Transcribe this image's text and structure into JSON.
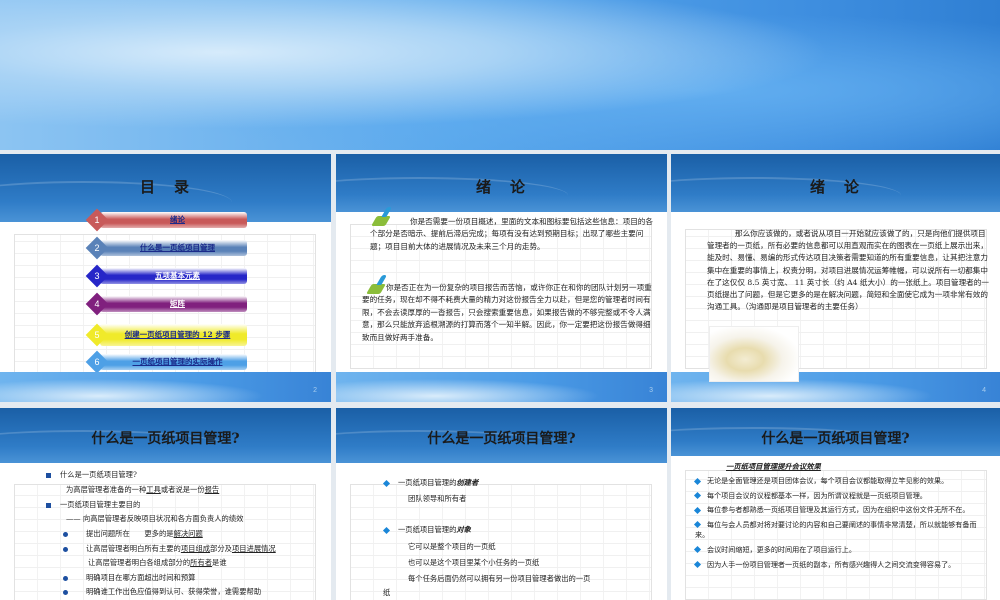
{
  "slides": [
    {
      "title": "目　录",
      "page": "2",
      "items": [
        {
          "num": "1",
          "label": "绪论",
          "color": "#c85a5a"
        },
        {
          "num": "2",
          "label": "什么是一页纸项目管理",
          "color": "#5a82b8"
        },
        {
          "num": "3",
          "label": "五项基本元素",
          "color": "#2626c8"
        },
        {
          "num": "4",
          "label": "矩阵",
          "color": "#80207e"
        },
        {
          "num": "5",
          "label": "创建一页纸项目管理的 12 步骤",
          "color": "#f0ea2a"
        },
        {
          "num": "6",
          "label": "一页纸项目管理的实际操作",
          "color": "#4ea0e6"
        }
      ]
    },
    {
      "title": "绪　论",
      "page": "3",
      "paragraphs": [
        "你是否需要一份项目概述，里面的文本和图标要包括这些信息：项目的各个部分是否暗示、提前后滞后完成；每项有没有达到预期目标；出现了哪些主要问题；项目目前大体的进展情况及未来三个月的走势。",
        "你是否正在为一份复杂的项目报告而苦恼，或许你正在和你的团队计划另一项重要的任务，现在却不得不耗费大量的精力对这份报告全力以赴，但是您的管理者时间有限，不会去读厚厚的一沓报告，只会搜索重要信息，如果报告做的不够完整或不令人满意，那么只能放弃追根溯源的打算而落个一知半解。因此，你一定要把这份报告做得细致而且做好两手准备。"
      ]
    },
    {
      "title": "绪　论",
      "page": "4",
      "paragraph": "那么你应该做的，或者说从项目一开始就应该做了的，只是向他们提供项目管理者的一页纸，所有必要的信息都可以用直观而实在的图表在一页纸上展示出来，能及时、易懂、易编的形式传达项目决策者需要知道的所有重要信息，让其把注意力集中在重要的事情上，权责分明，对项目进展情况运筹帷幄，可以说所有一切都集中在了这仅仅 8.5 英寸宽、 11 英寸长（约 A4 纸大小）的一张纸上。项目管理者的一页纸提出了问题，但是它更多的是在解决问题，简短和全面使它成为一项非常有效的沟通工具。（沟通即是项目管理者的主要任务）"
    },
    {
      "title": "什么是一页纸项目管理?",
      "q1": "什么是一页纸项目管理?",
      "a1_pre": "为高层管理者准备的一种",
      "a1_u1": "工具",
      "a1_mid": "或者说是一份",
      "a1_u2": "报告",
      "q2": "一页纸项目管理主要目的",
      "sub": "—— 向高层管理者反映项目状况和各方面负责人的绩效",
      "b1_pre": "提出问题所在　　更多的是",
      "b1_u": "解决问题",
      "b2_pre": "让高层管理者明白所有主要的",
      "b2_u1": "项目组成",
      "b2_mid": "部分及",
      "b2_u2": "项目进展情况",
      "b2b_pre": "让高层管理者明白各组成部分的",
      "b2b_u": "所有者",
      "b2b_post": "是谁",
      "b3": "明确项目在哪方面超出时间和预算",
      "b4": "明确谁工作出色应值得到认可、获得荣誉，谁需要帮助"
    },
    {
      "title": "什么是一页纸项目管理?",
      "c_pre": "一页纸项目管理的",
      "c_em": "创建者",
      "c_body": "团队领导和所有者",
      "o_pre": "一页纸项目管理的",
      "o_em": "对象",
      "o_lines": [
        "它可以是整个项目的一页纸",
        "也可以是这个项目里某个小任务的一页纸",
        "每个任务后面仍然可以拥有另一份项目管理者做出的一页"
      ],
      "o_tail": "纸"
    },
    {
      "title": "什么是一页纸项目管理?",
      "subtitle": "一页纸项目管理提升会议效果",
      "bullets": [
        "无论是全面管理还是项目团体会议，每个项目会议都能取得立竿见影的效果。",
        "每个项目会议的议程都基本一样，因为所谓议程就是一页纸项目管理。",
        "每位参与者都熟悉一页纸项目管理及其运行方式，因为在组织中这份文件无所不在。",
        "每位与会人员都对将对要讨论的内容和自己要阐述的事情非常清楚，所以就能够有备而来。",
        "会议时间缩短，更多的时间用在了项目运行上。",
        "因为人手一份项目管理者一页纸的副本，所有感兴趣得人之间交流变得容易了。"
      ]
    }
  ]
}
